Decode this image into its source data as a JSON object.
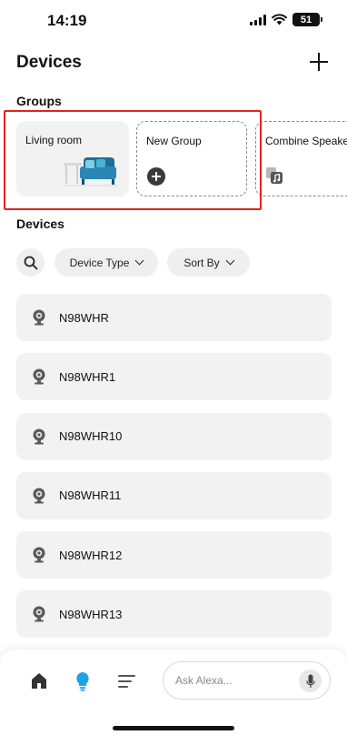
{
  "status_bar": {
    "time": "14:19",
    "battery": "51"
  },
  "header": {
    "title": "Devices",
    "add_icon": "plus-icon"
  },
  "groups": {
    "title": "Groups",
    "cards": [
      {
        "label": "Living room",
        "icon": "sofa-icon"
      },
      {
        "label": "New Group",
        "icon": "plus-circle-icon"
      },
      {
        "label": "Combine Speakers",
        "icon": "speaker-group-icon"
      }
    ]
  },
  "devices": {
    "title": "Devices",
    "filters": {
      "device_type": "Device Type",
      "sort_by": "Sort By"
    },
    "items": [
      {
        "name": "N98WHR",
        "icon": "camera-icon"
      },
      {
        "name": "N98WHR1",
        "icon": "camera-icon"
      },
      {
        "name": "N98WHR10",
        "icon": "camera-icon"
      },
      {
        "name": "N98WHR11",
        "icon": "camera-icon"
      },
      {
        "name": "N98WHR12",
        "icon": "camera-icon"
      },
      {
        "name": "N98WHR13",
        "icon": "camera-icon"
      }
    ]
  },
  "bottom_nav": {
    "items": [
      "home-icon",
      "devices-bulb-icon",
      "more-menu-icon"
    ],
    "active": "devices-bulb-icon",
    "alexa_placeholder": "Ask Alexa..."
  },
  "colors": {
    "highlight_border": "#e52220",
    "active_nav": "#1ea3e6",
    "card_bg": "#f2f2f2"
  }
}
